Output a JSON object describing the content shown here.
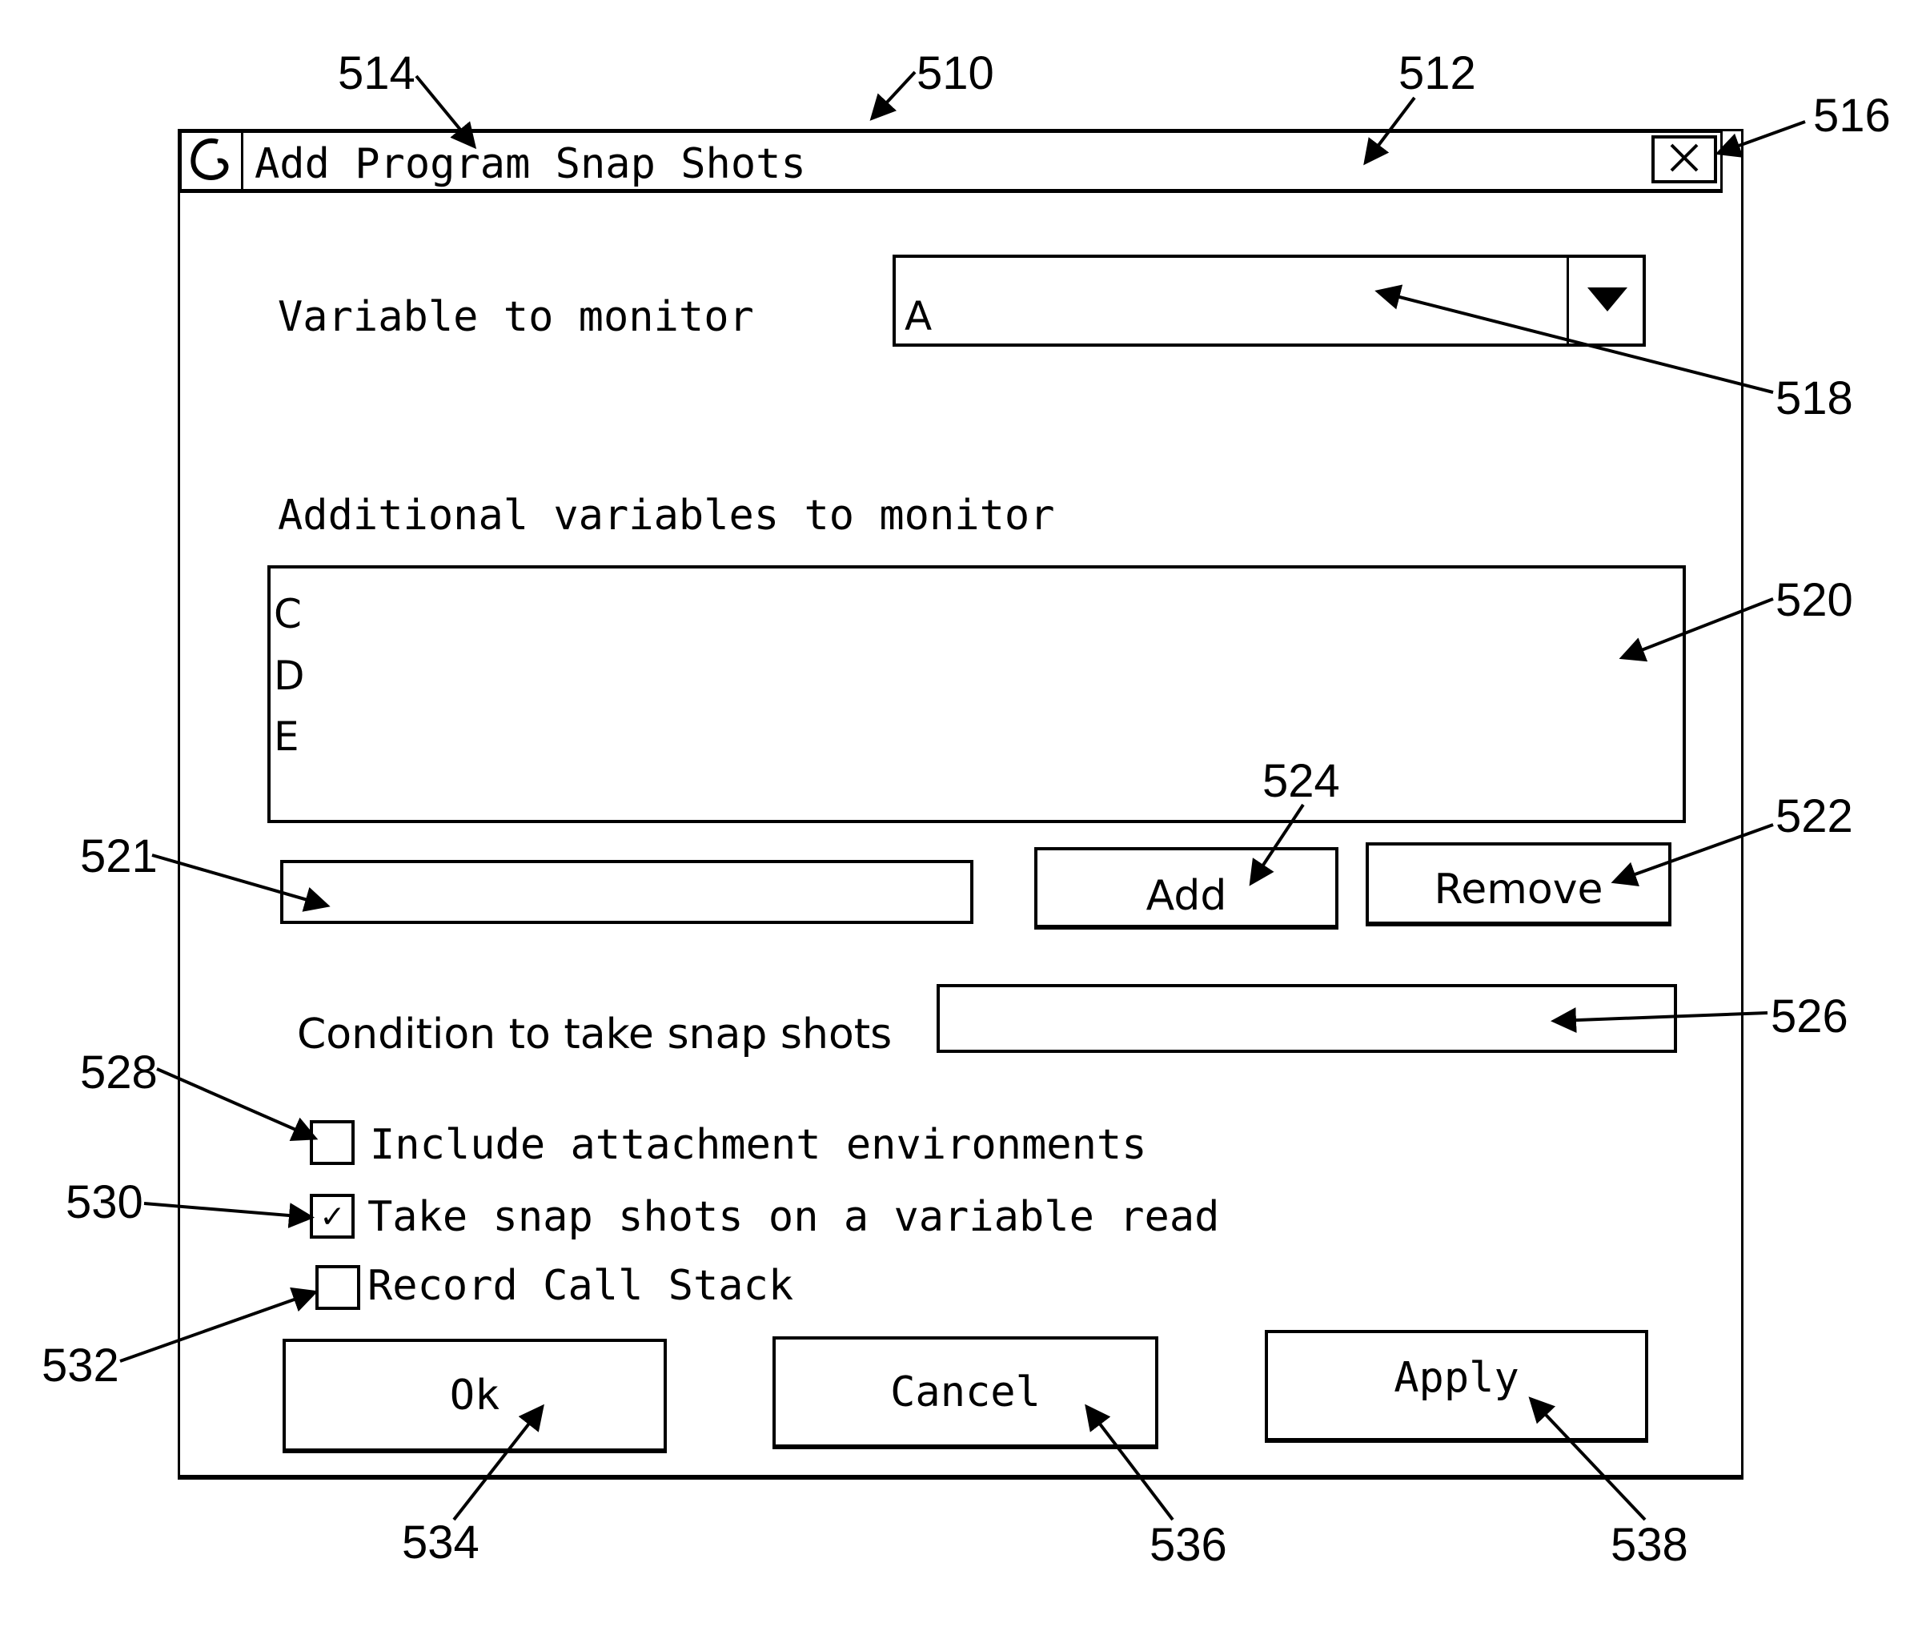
{
  "window": {
    "title": "Add Program Snap Shots",
    "system_menu_icon": "swirl-icon",
    "close_label": "✕"
  },
  "variable": {
    "label": "Variable to monitor",
    "selected": "A",
    "dropdown_icon": "▼"
  },
  "additional": {
    "label": "Additional variables to monitor",
    "items": [
      "C",
      "D",
      "E"
    ],
    "input_value": "",
    "add_label": "Add",
    "remove_label": "Remove"
  },
  "condition": {
    "label": "Condition to take snap shots",
    "value": ""
  },
  "options": [
    {
      "label": "Include attachment environments",
      "checked": false
    },
    {
      "label": "Take snap shots on a variable read",
      "checked": true
    },
    {
      "label": "Record Call Stack",
      "checked": false
    }
  ],
  "check_mark": "✓",
  "buttons": {
    "ok": "Ok",
    "cancel": "Cancel",
    "apply": "Apply"
  },
  "reference_numerals": {
    "window": "510",
    "title_bar": "512",
    "system_menu": "514",
    "close": "516",
    "variable_combo": "518",
    "list": "520",
    "list_input": "521",
    "remove": "522",
    "add": "524",
    "condition": "526",
    "opt_include": "528",
    "opt_read": "530",
    "opt_stack": "532",
    "ok": "534",
    "cancel": "536",
    "apply": "538"
  }
}
